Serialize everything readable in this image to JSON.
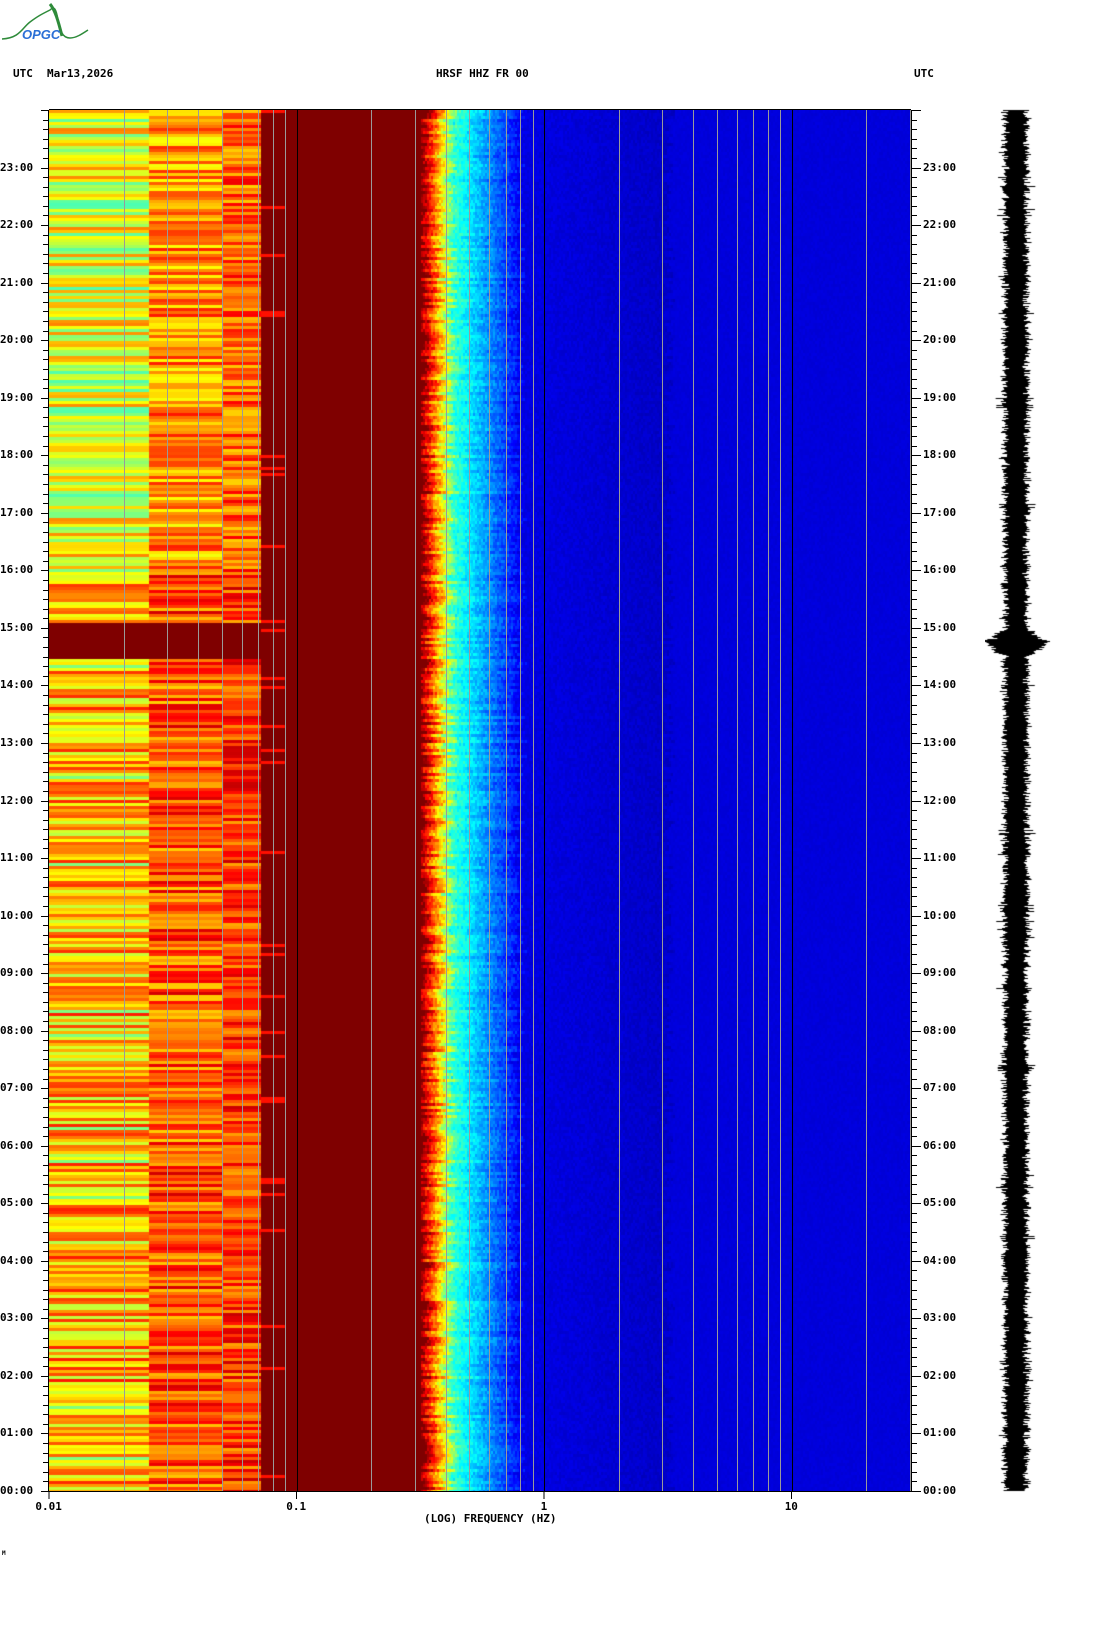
{
  "header": {
    "left_tz": "UTC",
    "date": "Mar13,2026",
    "station": "HRSF HHZ FR 00",
    "right_tz": "UTC",
    "logo_text": "OPGC"
  },
  "footer_mark": "M",
  "colors": {
    "high": "#800000",
    "low": "#0000a8",
    "grid": "#9a9a9a",
    "decade": "#000000"
  },
  "chart_data": {
    "type": "heatmap",
    "title": "HRSF HHZ FR 00",
    "xlabel": "(LOG) FREQUENCY (HZ)",
    "ylabel": "UTC",
    "xscale": "log",
    "xlim": [
      0.01,
      30
    ],
    "ylim_hours": [
      0,
      24
    ],
    "x_ticks": [
      {
        "v": 0.01,
        "label": "0.01"
      },
      {
        "v": 0.1,
        "label": "0.1"
      },
      {
        "v": 1,
        "label": "1"
      },
      {
        "v": 10,
        "label": "10"
      }
    ],
    "y_ticks": [
      "00:00",
      "01:00",
      "02:00",
      "03:00",
      "04:00",
      "05:00",
      "06:00",
      "07:00",
      "08:00",
      "09:00",
      "10:00",
      "11:00",
      "12:00",
      "13:00",
      "14:00",
      "15:00",
      "16:00",
      "17:00",
      "18:00",
      "19:00",
      "20:00",
      "21:00",
      "22:00",
      "23:00"
    ],
    "colormap": "jet (blue low power, dark red high power)",
    "features": [
      {
        "band_hz": [
          0.01,
          0.1
        ],
        "level": "high, striped"
      },
      {
        "band_hz": [
          0.1,
          0.3
        ],
        "level": "saturated"
      },
      {
        "band_hz": [
          0.3,
          0.7
        ],
        "level": "falloff (microseism)"
      },
      {
        "band_hz": [
          0.7,
          30
        ],
        "level": "low"
      },
      {
        "event_time": "14:45",
        "note": "amplitude burst in trace"
      }
    ],
    "grid": true
  }
}
